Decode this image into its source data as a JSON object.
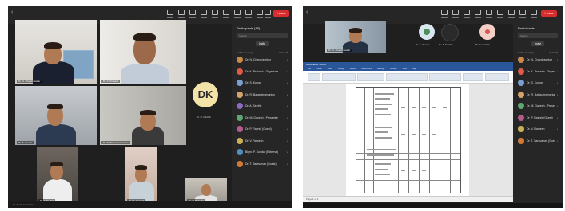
{
  "left": {
    "toolbar": {
      "leave_label": "Leave",
      "close_glyph": "×"
    },
    "participants_panel": {
      "title": "Participants (18)",
      "search_placeholder": "Search",
      "invite_label": "Invite",
      "section_label": "In this meeting",
      "section_action": "Mute all",
      "rows": [
        {
          "name": "Dr. N. Chandrasekar",
          "color": "#c98a4a"
        },
        {
          "name": "Dr. K. Prakash - Organizer",
          "color": "#e05a47"
        },
        {
          "name": "Dr. S. Kumar",
          "color": "#7a9fd0"
        },
        {
          "name": "Dr. R. Balasubramanian",
          "color": "#d4a26a"
        },
        {
          "name": "Dr. A. Senthil",
          "color": "#8a6bbf"
        },
        {
          "name": "Dr. M. Ganesh - Presenter",
          "color": "#5ea672"
        },
        {
          "name": "Dr. P. Rajesh (Guest)",
          "color": "#b35b8c"
        },
        {
          "name": "Dr. V. Ramesh",
          "color": "#c9b15a"
        },
        {
          "name": "Bigm. P. Sundar (External)",
          "color": "#4f8fb8"
        },
        {
          "name": "Dr. T. Saravanan (Guest)",
          "color": "#d07a3a"
        }
      ]
    },
    "tiles": [
      {
        "name": "Dr. N. Chandrasekar"
      },
      {
        "name": "Dr. K. Prakash"
      },
      {
        "name": "Dr. S. Kumar"
      },
      {
        "name": "Dr. R. Balasubramanian"
      },
      {
        "name": "Dr. A. Senthil"
      },
      {
        "name": "Dr. M. Ganesh"
      },
      {
        "name": "Dr. V. Ramesh"
      }
    ],
    "initials_tile": {
      "initials": "DK",
      "label": "Dr. D. Karthik"
    },
    "footer_label": "Dr. S. Ravichandran"
  },
  "right": {
    "toolbar": {
      "leave_label": "Leave",
      "close_glyph": "×"
    },
    "participants_panel": {
      "title": "Participants",
      "search_placeholder": "Search",
      "invite_label": "Invite",
      "section_label": "In this meeting",
      "section_action": "Mute all",
      "rows": [
        {
          "name": "Dr. N. Chandrasekar",
          "color": "#c98a4a"
        },
        {
          "name": "Dr. K. Prakash - Organizer",
          "color": "#e05a47"
        },
        {
          "name": "Dr. S. Kumar",
          "color": "#7a9fd0"
        },
        {
          "name": "Dr. R. Balasubramanian",
          "color": "#d4a26a"
        },
        {
          "name": "Dr. M. Ganesh - Presenter",
          "color": "#5ea672"
        },
        {
          "name": "Dr. P. Rajesh (Guest)",
          "color": "#b35b8c"
        },
        {
          "name": "Dr. V. Ramesh",
          "color": "#c9b15a"
        },
        {
          "name": "Dr. T. Saravanan (Guest)",
          "color": "#d07a3a"
        }
      ]
    },
    "video_strip": [
      {
        "name": "Dr. N. Chandrasekar"
      },
      {
        "name": "Dr. S. Kumar"
      },
      {
        "name": "Dr. A. Senthil"
      },
      {
        "name": "Dr. D. Karthik"
      }
    ],
    "word": {
      "title": "Document1 - Word",
      "menu": [
        "File",
        "Home",
        "Insert",
        "Design",
        "Layout",
        "References",
        "Mailings",
        "Review",
        "View",
        "Help"
      ],
      "status": "Page 1 of 3"
    }
  },
  "colors": {
    "meeting_bg": "#1f1f1f",
    "panel_bg": "#262626",
    "leave_red": "#d92c2c",
    "word_blue": "#2b579a"
  }
}
